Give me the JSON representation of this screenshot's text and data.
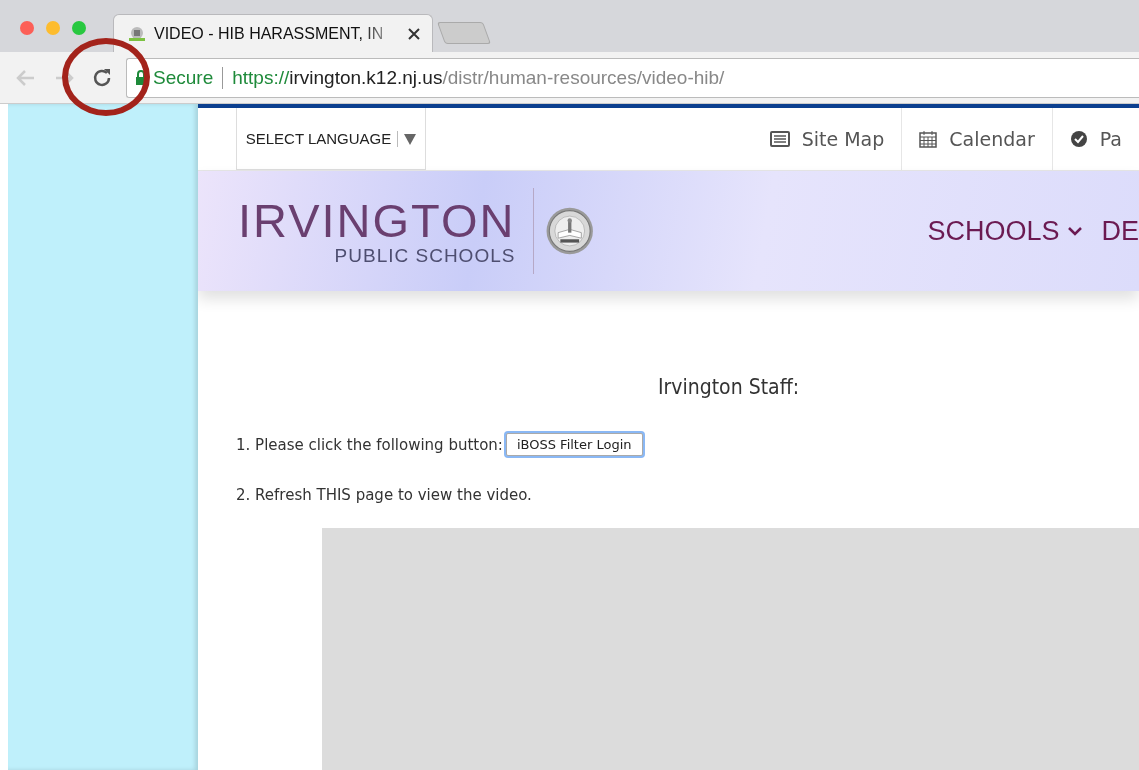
{
  "browser": {
    "tab": {
      "title": "VIDEO - HIB HARASSMENT, IN",
      "selected": true
    },
    "address": {
      "secure_label": "Secure",
      "scheme": "https://",
      "host": "irvington.k12.nj.us",
      "path": "/distr/human-resources/video-hib/"
    }
  },
  "utility_bar": {
    "language_select": "SELECT LANGUAGE",
    "links": [
      {
        "label": "Site Map"
      },
      {
        "label": "Calendar"
      },
      {
        "label": "Pa"
      }
    ]
  },
  "banner": {
    "title": "IRVINGTON",
    "subtitle": "PUBLIC SCHOOLS",
    "nav": [
      {
        "label": "SCHOOLS",
        "has_menu": true
      },
      {
        "label": "DE",
        "has_menu": false
      }
    ]
  },
  "content": {
    "heading": "Irvington Staff:",
    "step_1": "1. Please click the following button:",
    "login_button": "iBOSS Filter Login",
    "step_2": "2. Refresh THIS page to view the video."
  }
}
